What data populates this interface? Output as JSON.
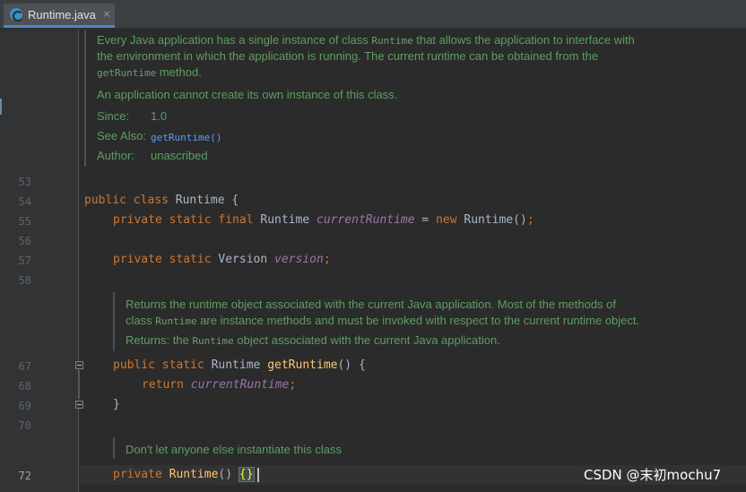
{
  "tab": {
    "label": "Runtime.java",
    "icon": "java-class-icon",
    "close": "×"
  },
  "doc_class": {
    "line1_pre": "Every Java application has a single instance of class ",
    "line1_code": "Runtime",
    "line1_post": " that allows the application to interface with",
    "line2": "the environment in which the application is running. The current runtime can be obtained from the",
    "line3_code": "getRuntime",
    "line3_post": " method.",
    "line4": "An application cannot create its own instance of this class.",
    "since_label": "Since:",
    "since_value": "1.0",
    "seealso_label": "See Also:",
    "seealso_value": "getRuntime()",
    "author_label": "Author:",
    "author_value": "unascribed"
  },
  "doc_method": {
    "line1": "Returns the runtime object associated with the current Java application. Most of the methods of",
    "line2_pre": "class ",
    "line2_code": "Runtime",
    "line2_post": " are instance methods and must be invoked with respect to the current runtime object.",
    "line3_pre": "Returns: the ",
    "line3_code": "Runtime",
    "line3_post": " object associated with the current Java application."
  },
  "doc_ctor": {
    "line1": "Don't let anyone else instantiate this class"
  },
  "line_numbers": [
    "53",
    "54",
    "55",
    "56",
    "57",
    "58",
    "67",
    "68",
    "69",
    "70",
    "72"
  ],
  "code": {
    "l54": {
      "kw": "public class ",
      "rest": "Runtime {"
    },
    "l55": {
      "kw1": "private static final ",
      "type": "Runtime ",
      "field": "currentRuntime",
      "eq": " = ",
      "kw2": "new ",
      "rest": "Runtime()",
      "semi": ";"
    },
    "l57": {
      "kw": "private static ",
      "type": "Version ",
      "field": "version",
      "semi": ";"
    },
    "l67": {
      "kw": "public static ",
      "type": "Runtime ",
      "method": "getRuntime",
      "rest": "() {"
    },
    "l68": {
      "kw": "return ",
      "field": "currentRuntime",
      "semi": ";"
    },
    "l69": {
      "rest": "}"
    },
    "l72": {
      "kw": "private ",
      "method": "Runtime",
      "rest": "() ",
      "brace": "{}"
    }
  },
  "watermark": "CSDN @末初mochu7",
  "colors": {
    "background": "#2b2b2b",
    "keyword": "#cc7832",
    "field": "#9876aa",
    "method": "#ffc66d",
    "doc": "#5d9e61",
    "link": "#589df6"
  }
}
